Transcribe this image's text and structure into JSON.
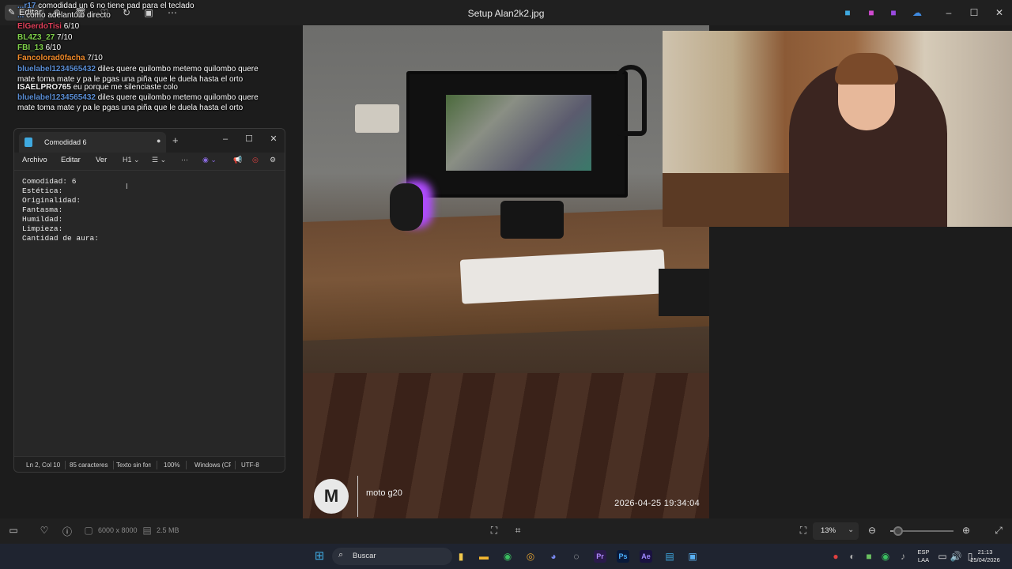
{
  "viewer": {
    "title": "Setup Alan2k2.jpg",
    "edit_label": "Editar",
    "dimensions": "6000 x 8000",
    "file_size": "2.5 MB",
    "zoom": "13%",
    "zoom_level": 0.13
  },
  "photo": {
    "camera": "moto g20",
    "timestamp": "2026-04-25  19:34:04"
  },
  "chat": [
    {
      "user": "...r17",
      "user_color": "#5b8fd6",
      "msg": "comodidad un 6 no tiene pad para el teclado"
    },
    {
      "user": "...",
      "user_color": "#5b8fd6",
      "msg": "como adelantó o directo"
    },
    {
      "user": "ElGerdoTisi",
      "user_color": "#e0405a",
      "msg": "6/10"
    },
    {
      "user": "BL4Z3_27",
      "user_color": "#7fd14a",
      "msg": "7/10"
    },
    {
      "user": "FBI_13",
      "user_color": "#7fd14a",
      "msg": "6/10"
    },
    {
      "user": "Fancolorad0facha",
      "user_color": "#f08a2a",
      "msg": "7/10"
    },
    {
      "user": "bluelabel1234565432",
      "user_color": "#5b8fd6",
      "msg": "diles quere quilombo metemo quilombo quere mate toma mate y pa le pgas una piña que le duela hasta el orto"
    },
    {
      "user": "ISAELPRO765",
      "user_color": "#f0f0f0",
      "msg": "eu porque me silenciaste colo"
    },
    {
      "user": "bluelabel1234565432",
      "user_color": "#5b8fd6",
      "msg": "diles quere quilombo metemo quilombo quere mate toma mate y pa le pgas una piña que le duela hasta el orto"
    }
  ],
  "notepad": {
    "tab_title": "Comodidad 6",
    "menu": [
      "Archivo",
      "Editar",
      "Ver"
    ],
    "heading_select": "H1",
    "lines": [
      "Comodidad: 6",
      "Estética:",
      "Originalidad:",
      "Fantasma:",
      "Humildad:",
      "Limpieza:",
      "Cantidad de aura:"
    ],
    "status": {
      "position": "Ln 2, Col 10",
      "chars": "85 caracteres",
      "format": "Texto sin formato",
      "zoom": "100%",
      "line_ending": "Windows (CRLF)",
      "encoding": "UTF-8"
    }
  },
  "taskbar": {
    "search_placeholder": "Buscar",
    "lang_top": "ESP",
    "lang_bottom": "LAA",
    "time": "21:13",
    "date": "25/04/2026"
  },
  "colors": {
    "accent": "#3fa9e0",
    "chat_blue": "#5b8fd6"
  }
}
